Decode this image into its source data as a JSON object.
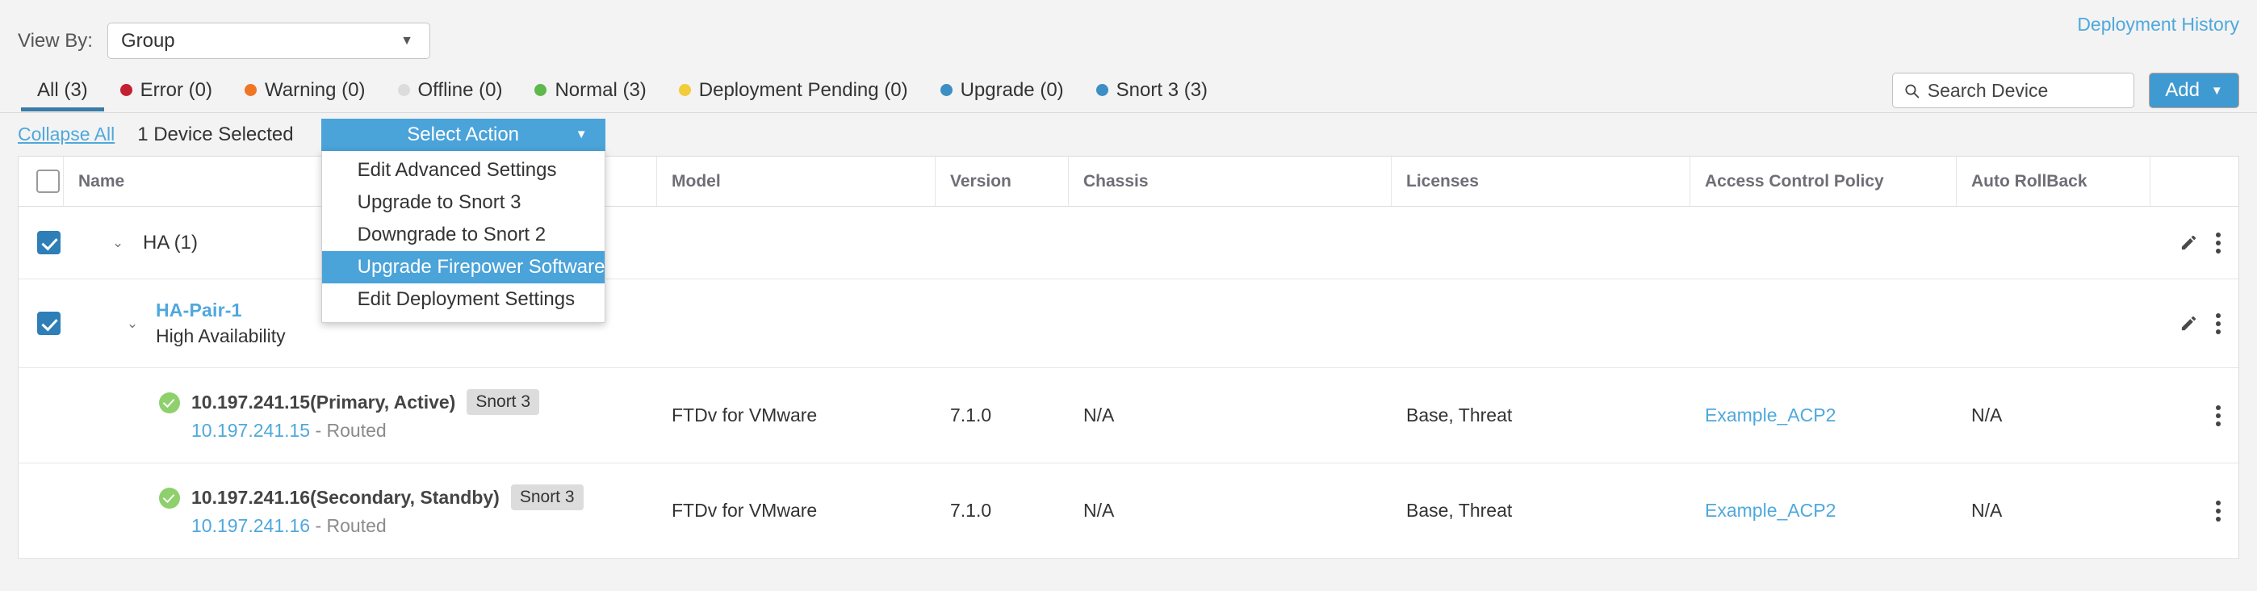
{
  "topbar": {
    "deployment_history": "Deployment History",
    "view_by_label": "View By:",
    "view_by_value": "Group",
    "caret_glyph": "▼"
  },
  "tabs": [
    {
      "label": "All (3)",
      "dot": null,
      "active": true
    },
    {
      "label": "Error (0)",
      "dot": "#c42032",
      "active": false
    },
    {
      "label": "Warning (0)",
      "dot": "#ef7622",
      "active": false
    },
    {
      "label": "Offline (0)",
      "dot": "#dcdcdc",
      "active": false
    },
    {
      "label": "Normal (3)",
      "dot": "#5eb84d",
      "active": false
    },
    {
      "label": "Deployment Pending (0)",
      "dot": "#f2cc39",
      "active": false
    },
    {
      "label": "Upgrade (0)",
      "dot": "#3b8fc4",
      "active": false
    },
    {
      "label": "Snort 3 (3)",
      "dot": "#3b8fc4",
      "active": false
    }
  ],
  "search": {
    "placeholder": "Search Device",
    "value": "",
    "icon": "search-icon"
  },
  "add_button": {
    "label": "Add",
    "caret": "▼"
  },
  "actionbar": {
    "collapse_all": "Collapse All",
    "device_selected": "1 Device Selected",
    "select_action_label": "Select Action",
    "select_action_caret": "▼",
    "menu_items": [
      {
        "label": "Edit Advanced Settings",
        "highlight": false
      },
      {
        "label": "Upgrade to Snort 3",
        "highlight": false
      },
      {
        "label": "Downgrade to Snort 2",
        "highlight": false
      },
      {
        "label": "Upgrade Firepower Software",
        "highlight": true
      },
      {
        "label": "Edit Deployment Settings",
        "highlight": false
      }
    ]
  },
  "table": {
    "headers": {
      "name": "Name",
      "model": "Model",
      "version": "Version",
      "chassis": "Chassis",
      "licenses": "Licenses",
      "acp": "Access Control Policy",
      "rollback": "Auto RollBack"
    },
    "group_row": {
      "title": "HA (1)",
      "checked": true,
      "chevron": "⌄"
    },
    "pair_row": {
      "name": "HA-Pair-1",
      "subtitle": "High Availability",
      "checked": true,
      "chevron": "⌄"
    },
    "devices": [
      {
        "title": "10.197.241.15(Primary, Active)",
        "badge": "Snort 3",
        "ip": "10.197.241.15",
        "mode": " - Routed",
        "model": "FTDv for VMware",
        "version": "7.1.0",
        "chassis": "N/A",
        "licenses": "Base, Threat",
        "acp": "Example_ACP2",
        "rollback": "N/A"
      },
      {
        "title": "10.197.241.16(Secondary, Standby)",
        "badge": "Snort 3",
        "ip": "10.197.241.16",
        "mode": " - Routed",
        "model": "FTDv for VMware",
        "version": "7.1.0",
        "chassis": "N/A",
        "licenses": "Base, Threat",
        "acp": "Example_ACP2",
        "rollback": "N/A"
      }
    ]
  },
  "colors": {
    "accent_blue": "#4aa3d9",
    "link_blue": "#4fa8dc",
    "tab_underline": "#3a7ca5",
    "checkbox_blue": "#2e7fb8",
    "status_green": "#8ed06c"
  }
}
